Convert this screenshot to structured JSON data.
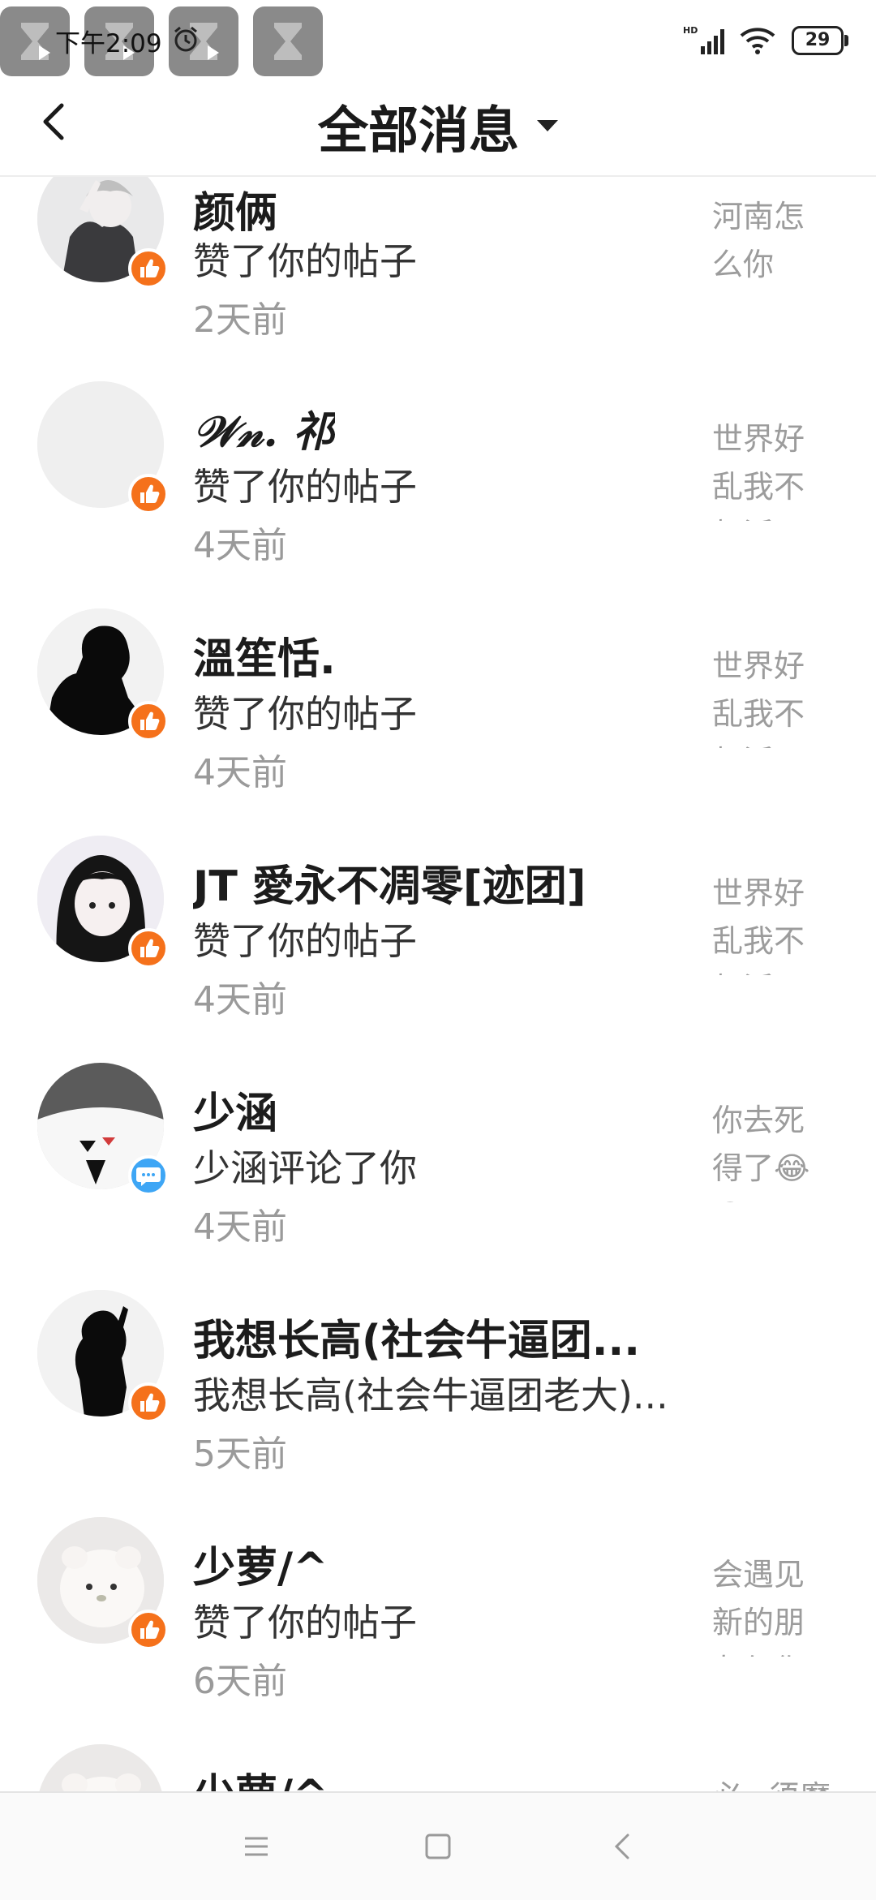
{
  "status_bar": {
    "time": "下午2:09",
    "battery": "29",
    "network": "HD"
  },
  "header": {
    "title": "全部消息"
  },
  "messages": [
    {
      "name": "颜俩",
      "action": "赞了你的帖子",
      "time": "2天前",
      "preview": "河南怎么你了？？",
      "type": "like"
    },
    {
      "name": "𝒲𝓃. 祁",
      "action": "赞了你的帖子",
      "time": "4天前",
      "preview": "世界好乱我不想活了",
      "type": "like"
    },
    {
      "name": "溫笙恬.",
      "action": "赞了你的帖子",
      "time": "4天前",
      "preview": "世界好乱我不想活了",
      "type": "like"
    },
    {
      "name": "JT  愛永不凋零[迹团]",
      "action": "赞了你的帖子",
      "time": "4天前",
      "preview": "世界好乱我不想活了",
      "type": "like"
    },
    {
      "name": "少涵",
      "action": "少涵评论了你",
      "time": "4天前",
      "preview": "你去死得了😂😂?...",
      "type": "comment"
    },
    {
      "name": "我想长高(社会牛逼团...",
      "action": "我想长高(社会牛逼团老大)...",
      "time": "5天前",
      "preview": "",
      "type": "like"
    },
    {
      "name": "少萝/^",
      "action": "赞了你的帖子",
      "time": "6天前",
      "preview": "会遇见新的朋友但你",
      "type": "like"
    },
    {
      "name": "少萝/^",
      "action": "",
      "time": "",
      "preview": "必~须魔",
      "type": "like"
    }
  ],
  "icons": {
    "back": "back-arrow-icon",
    "dropdown": "caret-down-icon",
    "like_badge": "thumbs-up-icon",
    "comment_badge": "comment-bubble-icon",
    "nav_menu": "menu-icon",
    "nav_home": "home-square-icon",
    "nav_back": "nav-back-icon"
  },
  "colors": {
    "like_badge": "#f5711b",
    "comment_badge": "#3ea6f5",
    "secondary_text": "#9a9a9a"
  }
}
